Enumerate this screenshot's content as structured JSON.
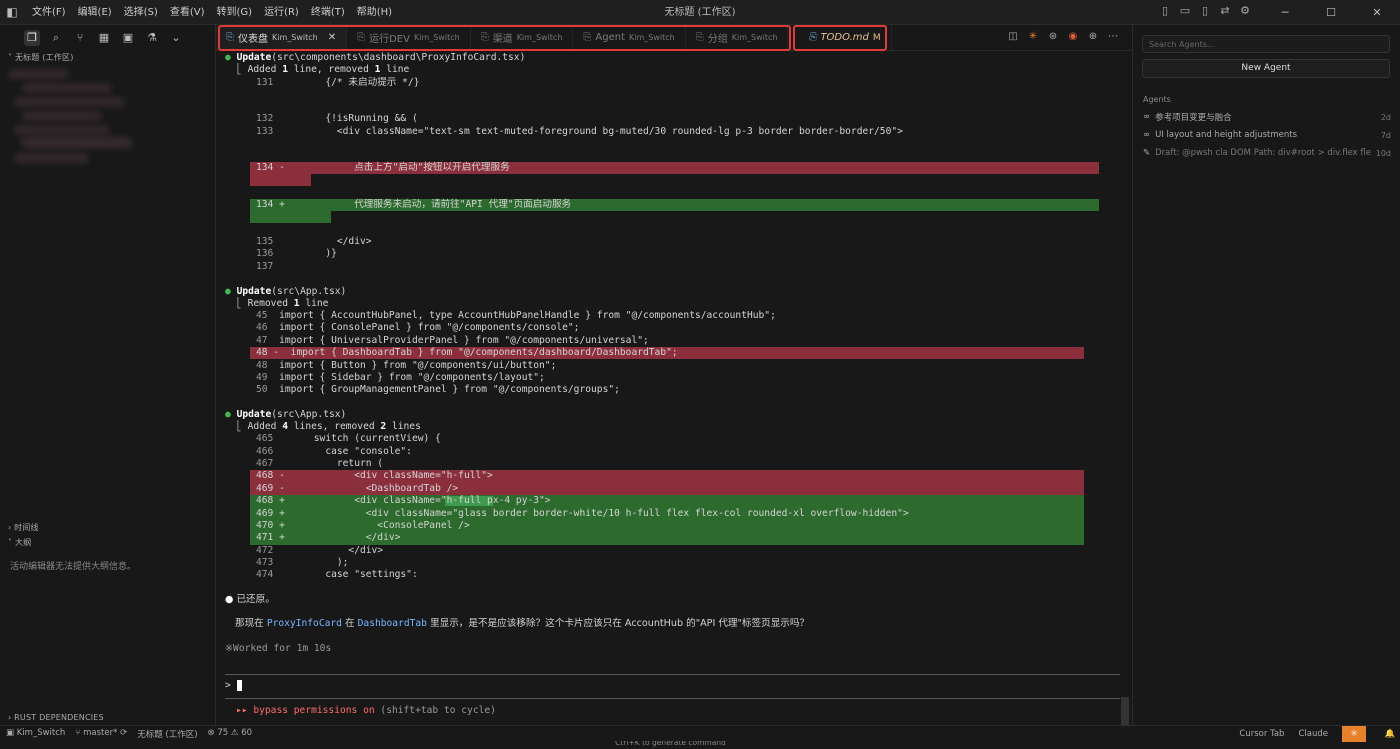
{
  "titlebar": {
    "menu": [
      "文件(F)",
      "编辑(E)",
      "选择(S)",
      "查看(V)",
      "转到(G)",
      "运行(R)",
      "终端(T)",
      "帮助(H)"
    ],
    "title": "无标题 (工作区)"
  },
  "sidebar": {
    "workspace_header": "无标题 (工作区)",
    "timeline_header": "时间线",
    "outline_header": "大纲",
    "outline_empty": "活动编辑器无法提供大纲信息。",
    "rust_header": "RUST DEPENDENCIES"
  },
  "tabs": [
    {
      "label": "仪表盘",
      "sub": "Kim_Switch",
      "active": true
    },
    {
      "label": "运行DEV",
      "sub": "Kim_Switch"
    },
    {
      "label": "渠道",
      "sub": "Kim_Switch"
    },
    {
      "label": "Agent",
      "sub": "Kim_Switch"
    },
    {
      "label": "分组",
      "sub": "Kim_Switch"
    },
    {
      "label": "TODO.md",
      "badge": "M"
    }
  ],
  "terminal": {
    "u1_title": "Update",
    "u1_file": "(src\\components\\dashboard\\ProxyInfoCard.tsx)",
    "u1_summary_a": "Added ",
    "u1_summary_n1": "1",
    "u1_summary_b": " line, removed ",
    "u1_summary_n2": "1",
    "u1_summary_c": " line",
    "u1_lines": [
      {
        "n": "131",
        "m": "",
        "code": "        {/* 未启动提示 */}"
      },
      {
        "n": "132",
        "m": "",
        "code": "        {!isRunning && ("
      },
      {
        "n": "133",
        "m": "",
        "code": "          <div className=\"text-sm text-muted-foreground bg-muted/30 rounded-lg p-3 border border-border/50\">"
      },
      {
        "n": "134",
        "m": "-",
        "code": "            点击上方\"启动\"按钮以开启代理服务"
      },
      {
        "n": "134",
        "m": "+",
        "code": "            代理服务未启动，请前往\"API 代理\"页面启动服务"
      },
      {
        "n": "135",
        "m": "",
        "code": "          </div>"
      },
      {
        "n": "136",
        "m": "",
        "code": "        )}"
      },
      {
        "n": "137",
        "m": "",
        "code": ""
      }
    ],
    "u2_title": "Update",
    "u2_file": "(src\\App.tsx)",
    "u2_summary_a": "Removed ",
    "u2_summary_n1": "1",
    "u2_summary_b": " line",
    "u2_lines": [
      {
        "n": "45",
        "m": "",
        "code": "  import { AccountHubPanel, type AccountHubPanelHandle } from \"@/components/accountHub\";"
      },
      {
        "n": "46",
        "m": "",
        "code": "  import { ConsolePanel } from \"@/components/console\";"
      },
      {
        "n": "47",
        "m": "",
        "code": "  import { UniversalProviderPanel } from \"@/components/universal\";"
      },
      {
        "n": "48",
        "m": "-",
        "code": "  import { DashboardTab } from \"@/components/dashboard/DashboardTab\";"
      },
      {
        "n": "48",
        "m": "",
        "code": "  import { Button } from \"@/components/ui/button\";"
      },
      {
        "n": "49",
        "m": "",
        "code": "  import { Sidebar } from \"@/components/layout\";"
      },
      {
        "n": "50",
        "m": "",
        "code": "  import { GroupManagementPanel } from \"@/components/groups\";"
      }
    ],
    "u3_title": "Update",
    "u3_file": "(src\\App.tsx)",
    "u3_summary_a": "Added ",
    "u3_summary_n1": "4",
    "u3_summary_b": " lines, removed ",
    "u3_summary_n2": "2",
    "u3_summary_c": " lines",
    "u3_lines": [
      {
        "n": "465",
        "m": "",
        "code": "      switch (currentView) {"
      },
      {
        "n": "466",
        "m": "",
        "code": "        case \"console\":"
      },
      {
        "n": "467",
        "m": "",
        "code": "          return ("
      },
      {
        "n": "468",
        "m": "-",
        "code": "            <div className=\"h-full\">"
      },
      {
        "n": "469",
        "m": "-",
        "code": "              <DashboardTab />"
      },
      {
        "n": "468",
        "m": "+",
        "code": "            <div className=\"h-full px-4 py-3\">"
      },
      {
        "n": "469",
        "m": "+",
        "code": "              <div className=\"glass border border-white/10 h-full flex flex-col rounded-xl overflow-hidden\">"
      },
      {
        "n": "470",
        "m": "+",
        "code": "                <ConsolePanel />"
      },
      {
        "n": "471",
        "m": "+",
        "code": "              </div>"
      },
      {
        "n": "472",
        "m": "",
        "code": "            </div>"
      },
      {
        "n": "473",
        "m": "",
        "code": "          );"
      },
      {
        "n": "474",
        "m": "",
        "code": "        case \"settings\":"
      }
    ],
    "restored": "已还原。",
    "question_a": "那现在 ",
    "question_comp1": "ProxyInfoCard",
    "question_b": " 在 ",
    "question_comp2": "DashboardTab",
    "question_c": " 里显示，是不是应该移除？这个卡片应该只在 AccountHub 的\"API 代理\"标签页显示吗？",
    "worked": "※Worked for 1m 10s",
    "prompt": ">",
    "bypass_arrows": "▸▸",
    "bypass_text": "bypass permissions on",
    "bypass_hint": "(shift+tab to cycle)",
    "hint": "Ctrl+K to generate command"
  },
  "agents": {
    "search_placeholder": "Search Agents...",
    "new_agent": "New Agent",
    "header": "Agents",
    "items": [
      {
        "title": "参考项目变更与融合",
        "age": "2d"
      },
      {
        "title": "UI layout and height adjustments",
        "age": "7d"
      },
      {
        "title": "Draft: @pwsh cla DOM Path: div#root > div.flex flex-...",
        "age": "10d"
      }
    ]
  },
  "statusbar": {
    "project": "Kim_Switch",
    "branch": "master*",
    "workspace": "无标题 (工作区)",
    "errors": "75",
    "warnings": "60",
    "cursor_tab": "Cursor Tab",
    "claude": "Claude"
  },
  "colors": {
    "removed_bg": "#8b2f3d",
    "added_bg": "#2d6a2d",
    "highlight_box": "#e03a3a"
  }
}
